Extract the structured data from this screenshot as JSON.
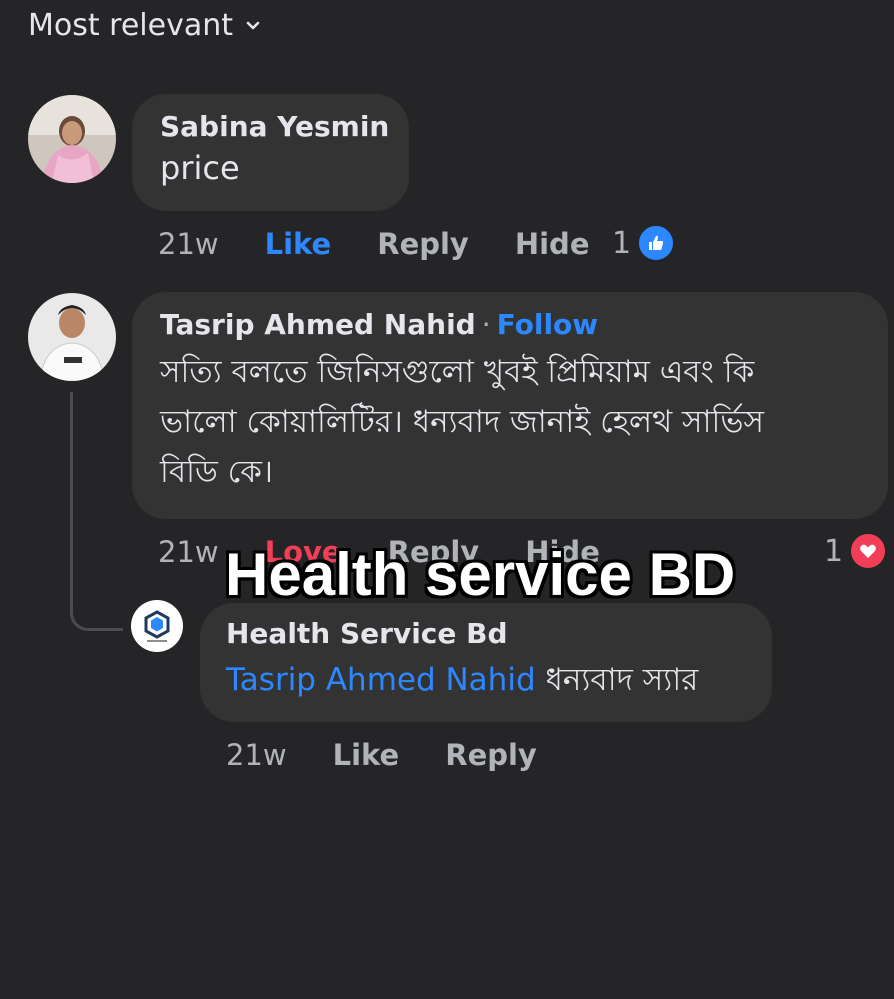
{
  "sort": {
    "label": "Most relevant",
    "icon": "chevron-down-icon"
  },
  "comments": [
    {
      "author": "Sabina Yesmin",
      "text": "price",
      "time": "21w",
      "like_label": "Like",
      "reply_label": "Reply",
      "hide_label": "Hide",
      "reaction_count": "1",
      "reaction_type": "like",
      "avatar_icon": "avatar"
    },
    {
      "author": "Tasrip Ahmed Nahid",
      "follow_label": "Follow",
      "separator": "·",
      "text_line1": "সত্যি বলতে জিনিসগুলো খুবই প্রিমিয়াম এবং কি",
      "text_line2": "ভালো কোয়ালিটির।  ধন্যবাদ জানাই হেলথ সার্ভিস",
      "text_line3": "বিডি কে।",
      "time": "21w",
      "love_label": "Love",
      "reply_label": "Reply",
      "hide_label": "Hide",
      "reaction_count": "1",
      "reaction_type": "love",
      "avatar_icon": "avatar"
    }
  ],
  "reply": {
    "author": "Health Service Bd",
    "mention": "Tasrip Ahmed Nahid",
    "text": "ধন্যবাদ স্যার",
    "time": "21w",
    "like_label": "Like",
    "reply_label": "Reply",
    "avatar_icon": "page-logo-icon"
  },
  "watermark": "Health service BD",
  "colors": {
    "background": "#252527",
    "bubble": "#333334",
    "accent_blue": "#2d88ff",
    "love_red": "#f33e58",
    "muted_text": "#b0b3b8"
  }
}
